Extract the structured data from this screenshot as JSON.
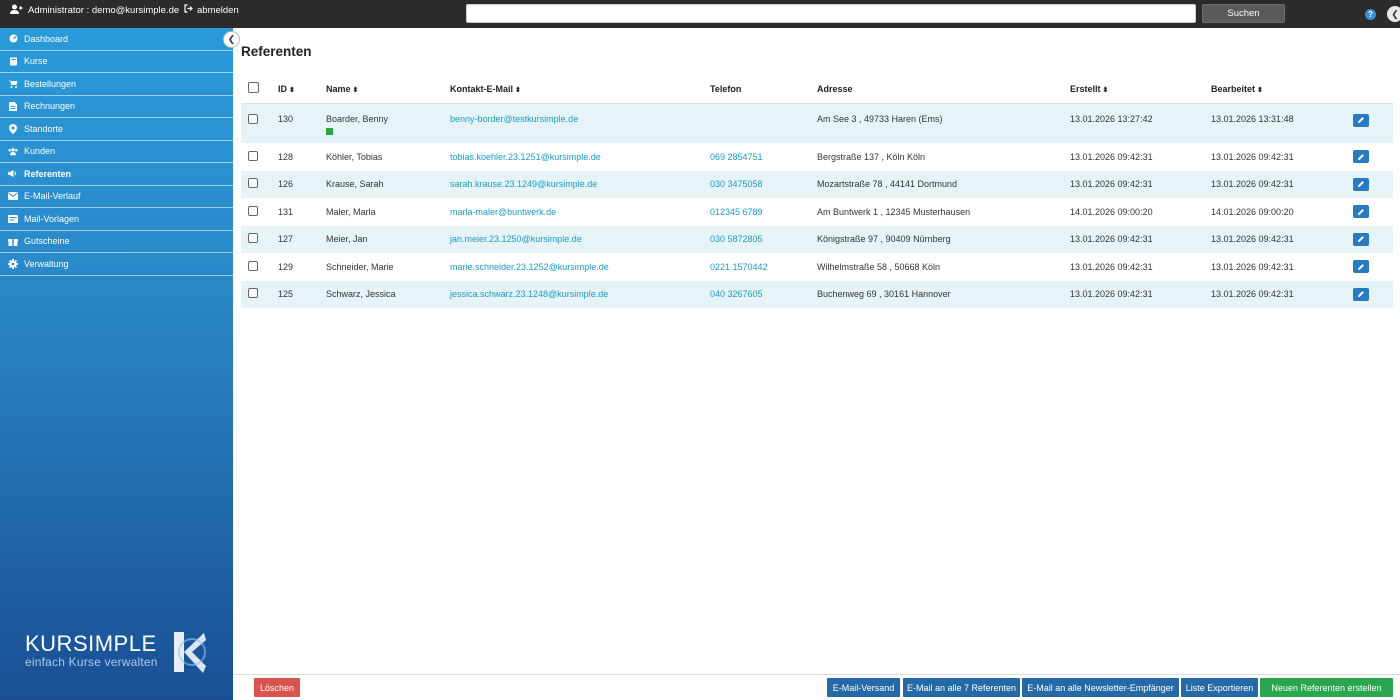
{
  "topbar": {
    "user_label": "Administrator : demo@kursimple.de",
    "logout_label": "abmelden",
    "search_placeholder": "",
    "search_button": "Suchen",
    "help_label": "?"
  },
  "sidebar": {
    "items": [
      {
        "label": "Dashboard",
        "icon": "dashboard-icon",
        "active": false
      },
      {
        "label": "Kurse",
        "icon": "book-icon",
        "active": false
      },
      {
        "label": "Bestellungen",
        "icon": "cart-icon",
        "active": false
      },
      {
        "label": "Rechnungen",
        "icon": "invoice-icon",
        "active": false
      },
      {
        "label": "Standorte",
        "icon": "location-icon",
        "active": false
      },
      {
        "label": "Kunden",
        "icon": "users-icon",
        "active": false
      },
      {
        "label": "Referenten",
        "icon": "speaker-icon",
        "active": true
      },
      {
        "label": "E-Mail-Verlauf",
        "icon": "envelope-icon",
        "active": false
      },
      {
        "label": "Mail-Vorlagen",
        "icon": "template-icon",
        "active": false
      },
      {
        "label": "Gutscheine",
        "icon": "gift-icon",
        "active": false
      },
      {
        "label": "Verwaltung",
        "icon": "gear-icon",
        "active": false
      }
    ],
    "brand_name": "KURSIMPLE",
    "brand_tagline": "einfach Kurse verwalten",
    "brand_mark": "K"
  },
  "main": {
    "title": "Referenten",
    "columns": {
      "id": "ID",
      "name": "Name",
      "email": "Kontakt-E-Mail",
      "phone": "Telefon",
      "address": "Adresse",
      "created": "Erstellt",
      "edited": "Bearbeitet"
    },
    "rows": [
      {
        "id": "130",
        "name": "Boarder, Benny",
        "email": "benny-border@testkursimple.de",
        "phone": "",
        "address": "Am See 3 , 49733 Haren (Ems)",
        "created": "13.01.2026 13:27:42",
        "edited": "13.01.2026 13:31:48"
      },
      {
        "id": "128",
        "name": "Köhler, Tobias",
        "email": "tobias.koehler.23.1251@kursimple.de",
        "phone": "069 2854751",
        "address": "Bergstraße 137 , Köln Köln",
        "created": "13.01.2026 09:42:31",
        "edited": "13.01.2026 09:42:31"
      },
      {
        "id": "126",
        "name": "Krause, Sarah",
        "email": "sarah.krause.23.1249@kursimple.de",
        "phone": "030 3475058",
        "address": "Mozartstraße 78 , 44141 Dortmund",
        "created": "13.01.2026 09:42:31",
        "edited": "13.01.2026 09:42:31"
      },
      {
        "id": "131",
        "name": "Maler, Marla",
        "email": "marla-maler@buntwerk.de",
        "phone": "012345 6789",
        "address": "Am Buntwerk 1 , 12345 Musterhausen",
        "created": "14.01.2026 09:00:20",
        "edited": "14.01.2026 09:00:20"
      },
      {
        "id": "127",
        "name": "Meier, Jan",
        "email": "jan.meier.23.1250@kursimple.de",
        "phone": "030 5872805",
        "address": "Königstraße 97 , 90409 Nürnberg",
        "created": "13.01.2026 09:42:31",
        "edited": "13.01.2026 09:42:31"
      },
      {
        "id": "129",
        "name": "Schneider, Marie",
        "email": "marie.schneider.23.1252@kursimple.de",
        "phone": "0221 1570442",
        "address": "Wilhelmstraße 58 , 50668 Köln",
        "created": "13.01.2026 09:42:31",
        "edited": "13.01.2026 09:42:31"
      },
      {
        "id": "125",
        "name": "Schwarz, Jessica",
        "email": "jessica.schwarz.23.1248@kursimple.de",
        "phone": "040 3267605",
        "address": "Buchenweg 69 , 30161 Hannover",
        "created": "13.01.2026 09:42:31",
        "edited": "13.01.2026 09:42:31"
      }
    ]
  },
  "bottombar": {
    "delete": "Löschen",
    "email_send": "E-Mail-Versand",
    "email_all": "E-Mail an alle 7 Referenten",
    "email_newsletter": "E-Mail an alle Newsletter-Empfänger",
    "export": "Liste Exportieren",
    "new": "Neuen Referenten erstellen"
  },
  "colors": {
    "topbar": "#2b2b2b",
    "sidebar_top": "#2a9ad8",
    "sidebar_bottom": "#1a4f93",
    "link": "#1a9cc8",
    "row_stripe": "#e7f4f7",
    "button_blue": "#2569a7",
    "button_green": "#2aa64e",
    "button_red": "#d9534f",
    "status_green": "#2aa640"
  }
}
